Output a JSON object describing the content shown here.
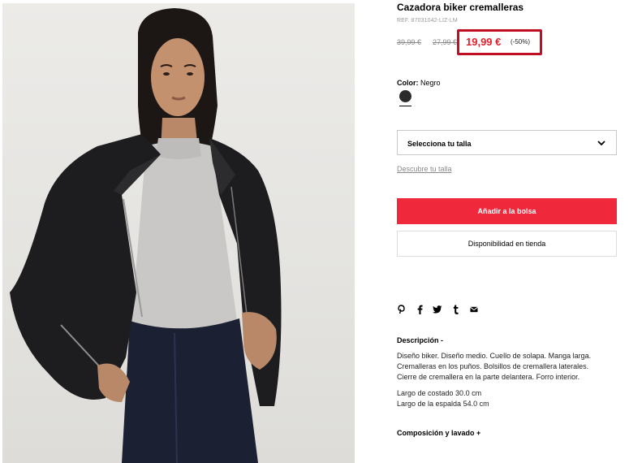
{
  "product": {
    "title": "Cazadora biker cremalleras",
    "ref": "REF. 87031042-LIZ-LM",
    "old_price_1": "39,99 €",
    "old_price_2": "27,99 €",
    "price": "19,99 €",
    "discount": "(-50%)",
    "image_alt": "Modelo con cazadora biker negra"
  },
  "color": {
    "label": "Color:",
    "value": "Negro",
    "swatch_color": "#2b2b2b"
  },
  "size": {
    "select_label": "Selecciona tu talla",
    "guide_link": "Descubre tu talla"
  },
  "actions": {
    "add_to_bag": "Añadir a la bolsa",
    "availability": "Disponibilidad en tienda"
  },
  "share": {
    "icons": [
      "pinterest-icon",
      "facebook-icon",
      "twitter-icon",
      "tumblr-icon",
      "email-icon"
    ]
  },
  "description": {
    "title": "Descripción -",
    "lines": [
      "Diseño biker. Diseño medio. Cuello de solapa. Manga larga.",
      "Cremalleras en los puños. Bolsillos de cremallera laterales.",
      "Cierre de cremallera en la parte delantera. Forro interior."
    ],
    "measures": [
      "Largo de costado 30.0 cm",
      "Largo de la espalda 54.0 cm"
    ]
  },
  "composition": {
    "title": "Composición y lavado +"
  },
  "colors": {
    "sale_red": "#e8202e",
    "highlight_border": "#c10f22",
    "button_red": "#f0283c"
  }
}
